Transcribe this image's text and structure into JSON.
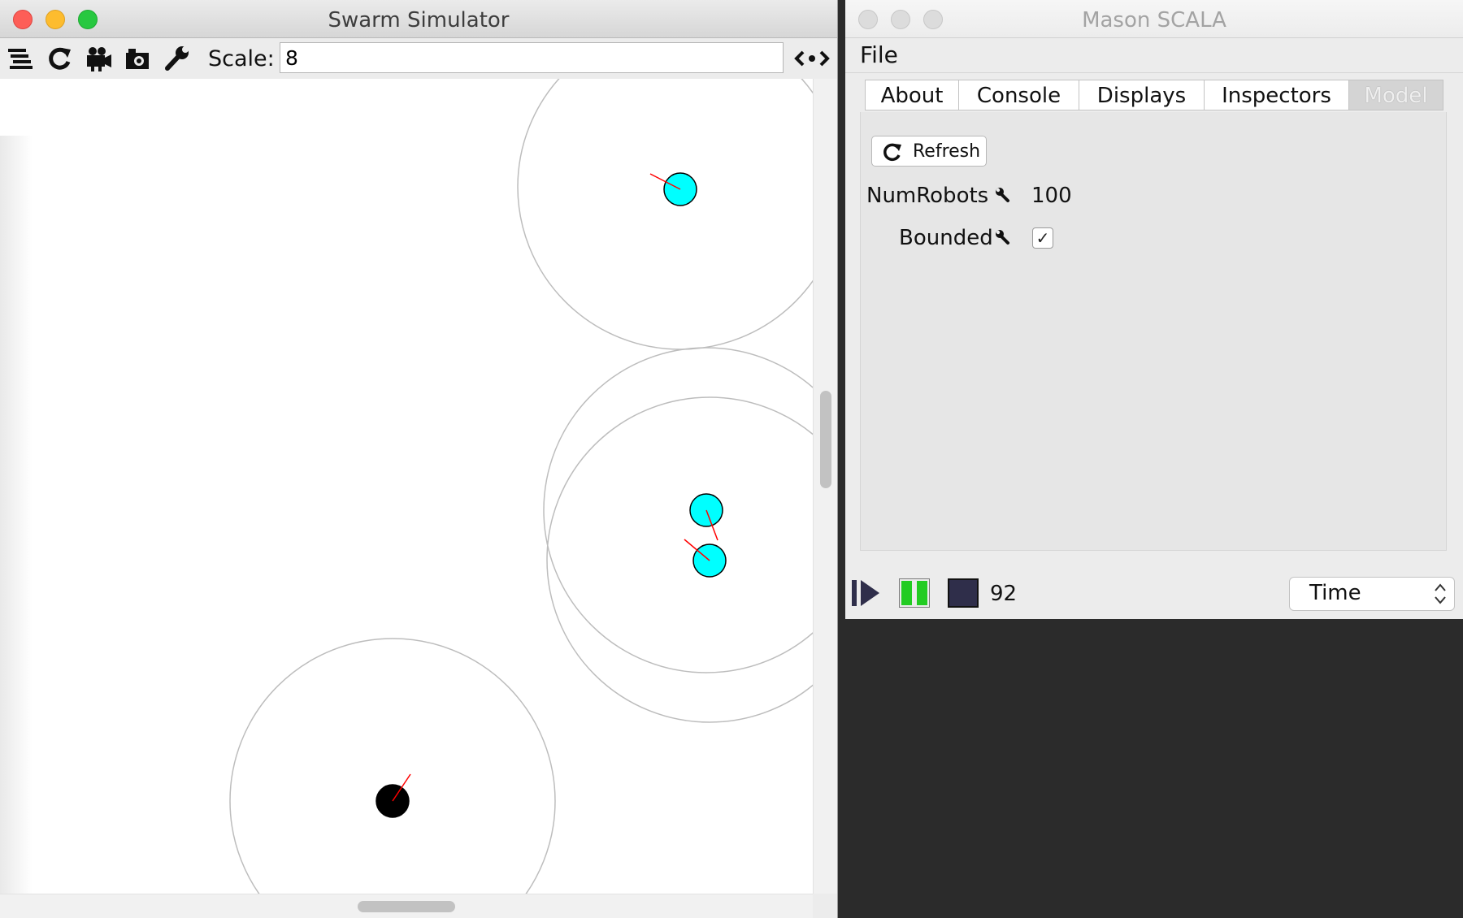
{
  "swarm_window": {
    "title": "Swarm Simulator",
    "toolbar": {
      "icons": [
        "layers-icon",
        "refresh-icon",
        "movie-camera-icon",
        "snapshot-camera-icon",
        "wrench-icon"
      ],
      "scale_label": "Scale:",
      "scale_value": "8",
      "nav_icon": "nav-arrows-icon"
    },
    "canvas": {
      "background": "#ffffff",
      "robot_color": "#00ffff",
      "highlight_robot_color": "#000000",
      "heading_color": "#ff0000",
      "sensor_ring_color": "#bdbdbd"
    }
  },
  "mason_window": {
    "title": "Mason SCALA",
    "menu": {
      "file": "File"
    },
    "tabs": [
      {
        "label": "About"
      },
      {
        "label": "Console"
      },
      {
        "label": "Displays"
      },
      {
        "label": "Inspectors"
      },
      {
        "label": "Model"
      }
    ],
    "selected_tab": "Model",
    "refresh_label": "Refresh",
    "properties": [
      {
        "label": "NumRobots",
        "value": "100"
      },
      {
        "label": "Bounded",
        "checked": true,
        "check_glyph": "✓"
      }
    ],
    "controls": {
      "play_icon": "step-play-icon",
      "pause_icon": "pause-icon",
      "stop_icon": "stop-icon",
      "steps": "92",
      "time_select": "Time",
      "play_color": "#2f2e4a",
      "pause_color": "#22cc22"
    }
  }
}
